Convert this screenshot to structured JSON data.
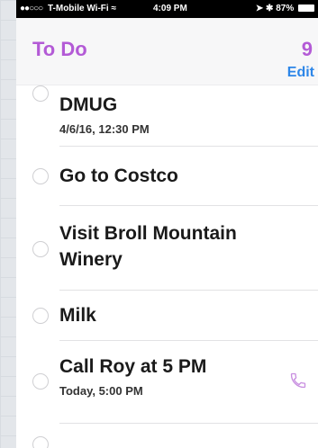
{
  "status_bar": {
    "carrier": "T-Mobile Wi-Fi",
    "time": "4:09 PM",
    "battery": "87%"
  },
  "header": {
    "list_title": "To Do",
    "count": "9",
    "edit_label": "Edit"
  },
  "items": [
    {
      "title": "DMUG",
      "subtitle": "4/6/16, 12:30 PM"
    },
    {
      "title": "Go to Costco"
    },
    {
      "title_line1": "Visit Broll Mountain",
      "title_line2": "Winery"
    },
    {
      "title": "Milk"
    },
    {
      "title": "Call Roy at 5 PM",
      "subtitle": "Today, 5:00 PM",
      "icon": "phone-icon"
    }
  ],
  "colors": {
    "accent": "#b35ad6",
    "edit_blue": "#2d86e8"
  }
}
